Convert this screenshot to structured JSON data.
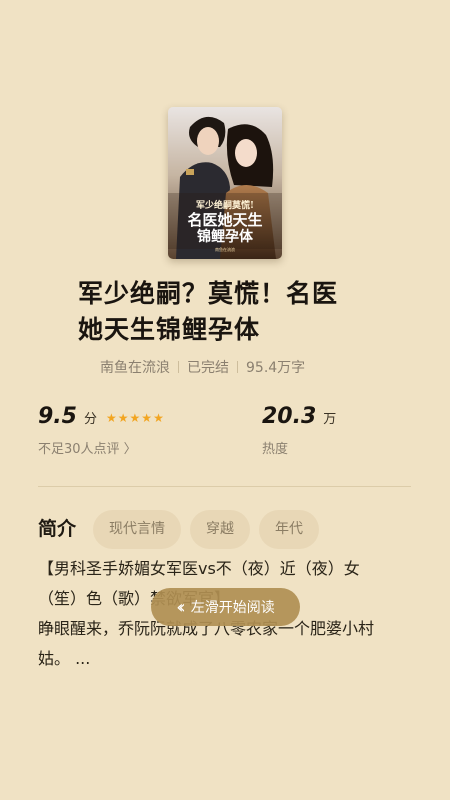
{
  "book": {
    "title_line1": "军少绝嗣？莫慌！名医",
    "title_line2": "她天生锦鲤孕体",
    "cover_text": "军少绝嗣莫慌！名医她天生锦鲤孕体",
    "author": "南鱼在流浪",
    "status": "已完结",
    "word_count": "95.4万字"
  },
  "stats": {
    "rating": {
      "value": "9.5",
      "unit": "分",
      "stars": 5,
      "note": "不足30人点评 〉"
    },
    "heat": {
      "value": "20.3",
      "unit": "万",
      "label": "热度"
    }
  },
  "intro": {
    "label": "简介",
    "tags": [
      "现代言情",
      "穿越",
      "年代"
    ],
    "line1": "【男科圣手娇媚女军医vs不（夜）近（夜）女",
    "line2": "（笙）色（歌）禁欲军官】",
    "line3": "睁眼醒来，乔阮阮就成了八零农家一个肥婆小村",
    "line4": "姑。 ..."
  },
  "swipe_button": {
    "icon": "double-chevron-left-icon",
    "label": "左滑开始阅读"
  },
  "colors": {
    "background": "#f0e2c4",
    "star": "#f2a521",
    "button": "#b08f52",
    "tag_bg": "#e8d7b6"
  }
}
